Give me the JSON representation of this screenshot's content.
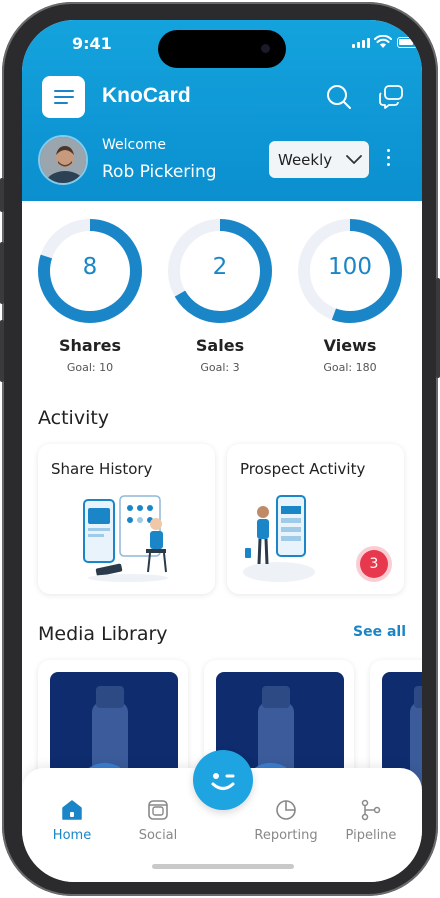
{
  "status_bar": {
    "time": "9:41"
  },
  "header": {
    "app_name": "KnoCard",
    "welcome": "Welcome",
    "user_name": "Rob Pickering",
    "period": "Weekly"
  },
  "stats": [
    {
      "value": "8",
      "label": "Shares",
      "goal": "Goal: 10",
      "progress": 0.8
    },
    {
      "value": "2",
      "label": "Sales",
      "goal": "Goal: 3",
      "progress": 0.667
    },
    {
      "value": "100",
      "label": "Views",
      "goal": "Goal: 180",
      "progress": 0.556
    }
  ],
  "activity": {
    "title": "Activity",
    "cards": [
      {
        "title": "Share History"
      },
      {
        "title": "Prospect Activity",
        "badge": "3"
      }
    ]
  },
  "media": {
    "title": "Media Library",
    "see_all": "See all"
  },
  "tabs": [
    {
      "label": "Home",
      "icon": "home-icon",
      "active": true
    },
    {
      "label": "Social",
      "icon": "social-icon",
      "active": false
    },
    {
      "label": "Reporting",
      "icon": "pie-chart-icon",
      "active": false
    },
    {
      "label": "Pipeline",
      "icon": "pipeline-icon",
      "active": false
    }
  ],
  "colors": {
    "primary": "#1a86c7",
    "header": "#14a3dd",
    "badge": "#e8384d",
    "ring_track": "#edf1f7"
  }
}
